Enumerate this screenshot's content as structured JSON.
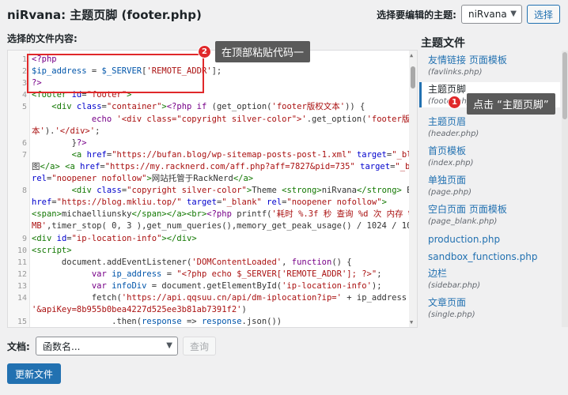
{
  "header": {
    "title": "niRvana: 主题页脚 (footer.php)",
    "select_theme_label": "选择要编辑的主题:",
    "theme_value": "niRvana",
    "select_button": "选择"
  },
  "editor": {
    "label": "选择的文件内容:",
    "lines": [
      {
        "n": "1",
        "html": "<span class=\"kw\">&lt;?php</span>"
      },
      {
        "n": "2",
        "html": "<span class=\"vr\">$ip_address</span> = <span class=\"vr\">$_SERVER</span>[<span class=\"st\">'REMOTE_ADDR'</span>];"
      },
      {
        "n": "3",
        "html": "<span class=\"kw\">?&gt;</span>"
      },
      {
        "n": "4",
        "html": "<span class=\"tg\">&lt;footer</span> <span class=\"at\">id</span>=<span class=\"st\">\"footer\"</span><span class=\"tg\">&gt;</span>"
      },
      {
        "n": "5",
        "html": "    <span class=\"tg\">&lt;div</span> <span class=\"at\">class</span>=<span class=\"st\">\"container\"</span><span class=\"tg\">&gt;</span><span class=\"kw\">&lt;?php</span> <span class=\"kw\">if</span> (get_option(<span class=\"st\">'footer版权文本'</span>)) {"
      },
      {
        "n": "",
        "html": "            <span class=\"kw\">echo</span> <span class=\"st\">'&lt;div class=\"copyright silver-color\"&gt;'</span>.get_option(<span class=\"st\">'footer版权文</span>"
      },
      {
        "n": "",
        "html": "<span class=\"st\">本'</span>).<span class=\"st\">'&lt;/div&gt;'</span>;"
      },
      {
        "n": "6",
        "html": "        }<span class=\"kw\">?&gt;</span>"
      },
      {
        "n": "7",
        "html": "        <span class=\"tg\">&lt;a</span> <span class=\"at\">href</span>=<span class=\"st\">\"https://bufan.blog/wp-sitemap-posts-post-1.xml\"</span> <span class=\"at\">target</span>=<span class=\"st\">\"_blank\"</span><span class=\"tg\">&gt;</span>站点地"
      },
      {
        "n": "",
        "html": "图<span class=\"tg\">&lt;/a&gt;</span> <span class=\"tg\">&lt;a</span> <span class=\"at\">href</span>=<span class=\"st\">\"https://my.racknerd.com/aff.php?aff=7827&amp;pid=735\"</span> <span class=\"at\">target</span>=<span class=\"st\">\"_blank\"</span>"
      },
      {
        "n": "",
        "html": "<span class=\"at\">rel</span>=<span class=\"st\">\"noopener nofollow\"</span><span class=\"tg\">&gt;</span>网站托管于RackNerd<span class=\"tg\">&lt;/a&gt;</span>"
      },
      {
        "n": "8",
        "html": "        <span class=\"tg\">&lt;div</span> <span class=\"at\">class</span>=<span class=\"st\">\"copyright silver-color\"</span><span class=\"tg\">&gt;</span>Theme <span class=\"tg\">&lt;strong&gt;</span>niRvana<span class=\"tg\">&lt;/strong&gt;</span> By <span class=\"tg\">&lt;a</span>"
      },
      {
        "n": "",
        "html": "<span class=\"at\">href</span>=<span class=\"st\">\"https://blog.mkliu.top/\"</span> <span class=\"at\">target</span>=<span class=\"st\">\"_blank\"</span> <span class=\"at\">rel</span>=<span class=\"st\">\"noopener nofollow\"</span><span class=\"tg\">&gt;</span>"
      },
      {
        "n": "",
        "html": "<span class=\"tg\">&lt;span&gt;</span>michaelliunsky<span class=\"tg\">&lt;/span&gt;&lt;/a&gt;&lt;br&gt;</span><span class=\"kw\">&lt;?php</span> printf(<span class=\"st\">'耗时 %.3f 秒 查询 %d 次 内存 %.2f</span>"
      },
      {
        "n": "",
        "html": "<span class=\"st\">MB'</span>,timer_stop( 0, 3 ),get_num_queries(),memory_get_peak_usage() / 1024 / 1024);<span class=\"kw\">?&gt;</span>"
      },
      {
        "n": "9",
        "html": "<span class=\"tg\">&lt;div</span> <span class=\"at\">id</span>=<span class=\"st\">\"ip-location-info\"</span><span class=\"tg\">&gt;&lt;/div&gt;</span>"
      },
      {
        "n": "10",
        "html": "<span class=\"tg\">&lt;script&gt;</span>"
      },
      {
        "n": "11",
        "html": "      document.addEventListener(<span class=\"st\">'DOMContentLoaded'</span>, <span class=\"kw\">function</span>() {"
      },
      {
        "n": "12",
        "html": "            <span class=\"kw\">var</span> <span class=\"vr\">ip_address</span> = <span class=\"st\">\"&lt;?php echo $_SERVER['REMOTE_ADDR']; ?&gt;\"</span>;"
      },
      {
        "n": "13",
        "html": "            <span class=\"kw\">var</span> <span class=\"vr\">infoDiv</span> = document.getElementById(<span class=\"st\">'ip-location-info'</span>);"
      },
      {
        "n": "14",
        "html": "            fetch(<span class=\"st\">'https://api.qqsuu.cn/api/dm-iplocation?ip='</span> + ip_address +"
      },
      {
        "n": "",
        "html": "<span class=\"st\">'&amp;apiKey=8b955b0bea4227d525ee3b81ab7391f2'</span>)"
      },
      {
        "n": "15",
        "html": "                .then(<span class=\"vr\">response</span> =&gt; <span class=\"vr\">response</span>.json())"
      }
    ]
  },
  "annotations": {
    "badge1": "1",
    "badge2": "2",
    "callout_top": "在顶部粘贴代码一",
    "callout_side": "点击 “主题页脚”"
  },
  "sidebar": {
    "title": "主题文件",
    "items": [
      {
        "name": "友情链接 页面模板",
        "path": "(favlinks.php)",
        "active": false
      },
      {
        "name": "主题页脚",
        "path": "(footer.php)",
        "active": true
      },
      {
        "name": "主题页眉",
        "path": "(header.php)",
        "active": false
      },
      {
        "name": "首页模板",
        "path": "(index.php)",
        "active": false
      },
      {
        "name": "单独页面",
        "path": "(page.php)",
        "active": false
      },
      {
        "name": "空白页面 页面模板",
        "path": "(page_blank.php)",
        "active": false
      },
      {
        "name": "production.php",
        "path": "",
        "active": false
      },
      {
        "name": "sandbox_functions.php",
        "path": "",
        "active": false
      },
      {
        "name": "边栏",
        "path": "(sidebar.php)",
        "active": false
      },
      {
        "name": "文章页面",
        "path": "(single.php)",
        "active": false
      }
    ]
  },
  "footer": {
    "doc_label": "文档:",
    "doc_placeholder": "函数名...",
    "lookup_button": "查询",
    "update_button": "更新文件"
  },
  "colors": {
    "accent": "#2271b1",
    "annotation_red": "#e0282a",
    "callout_bg": "#5a5a5a"
  }
}
